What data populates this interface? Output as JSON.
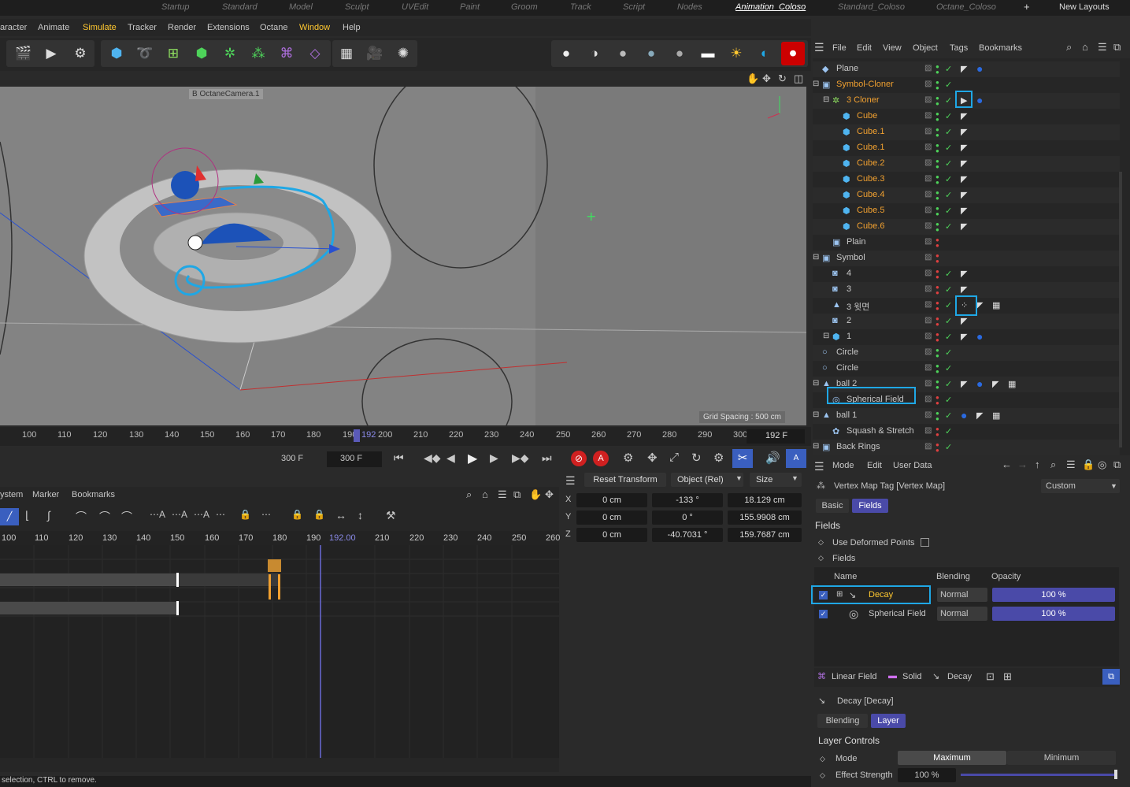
{
  "layout_tabs": [
    "Startup",
    "Standard",
    "Model",
    "Sculpt",
    "UVEdit",
    "Paint",
    "Groom",
    "Track",
    "Script",
    "Nodes",
    "Animation_Coloso",
    "Standard_Coloso",
    "Octane_Coloso",
    "+",
    "New Layouts"
  ],
  "menu": [
    "aracter",
    "Animate",
    "Simulate",
    "Tracker",
    "Render",
    "Extensions",
    "Octane",
    "Window",
    "Help"
  ],
  "viewport": {
    "camera_label": "B OctaneCamera.1",
    "grid_spacing": "Grid Spacing : 500 cm"
  },
  "ruler": {
    "ticks": [
      "100",
      "110",
      "120",
      "130",
      "140",
      "150",
      "160",
      "170",
      "180",
      "190",
      "200",
      "210",
      "220",
      "230",
      "240",
      "250",
      "260",
      "270",
      "280",
      "290",
      "300"
    ],
    "current_marker": "192",
    "current_frame": "192 F"
  },
  "transport": {
    "min_frame": "300 F",
    "max_frame": "300 F"
  },
  "timeline": {
    "menu": [
      "ystem",
      "Marker",
      "Bookmarks"
    ],
    "ticks": [
      "100",
      "110",
      "120",
      "130",
      "140",
      "150",
      "160",
      "170",
      "180",
      "190",
      "192.00",
      "210",
      "220",
      "230",
      "240",
      "250",
      "260"
    ]
  },
  "coord": {
    "reset": "Reset Transform",
    "mode": "Object (Rel)",
    "size": "Size",
    "axes": [
      "X",
      "Y",
      "Z"
    ],
    "pos": [
      "0 cm",
      "0 cm",
      "0 cm"
    ],
    "rot": [
      "-133 °",
      "0 °",
      "-40.7031 °"
    ],
    "scale": [
      "18.129 cm",
      "155.9908 cm",
      "159.7687 cm"
    ]
  },
  "status": "selection, CTRL to remove.",
  "object_manager": {
    "menu": [
      "File",
      "Edit",
      "View",
      "Object",
      "Tags",
      "Bookmarks"
    ],
    "rows": [
      {
        "name": "Plane",
        "color": "#c8c8c8",
        "indent": 0,
        "icon": "◆"
      },
      {
        "name": "Symbol-Cloner",
        "color": "#f0a030",
        "indent": 0,
        "icon": "▣"
      },
      {
        "name": "3 Cloner",
        "color": "#f0a030",
        "indent": 1,
        "icon": "✲"
      },
      {
        "name": "Cube",
        "color": "#f0a030",
        "indent": 2,
        "icon": "⬢"
      },
      {
        "name": "Cube.1",
        "color": "#f0a030",
        "indent": 2,
        "icon": "⬢"
      },
      {
        "name": "Cube.1",
        "color": "#f0a030",
        "indent": 2,
        "icon": "⬢"
      },
      {
        "name": "Cube.2",
        "color": "#f0a030",
        "indent": 2,
        "icon": "⬢"
      },
      {
        "name": "Cube.3",
        "color": "#f0a030",
        "indent": 2,
        "icon": "⬢"
      },
      {
        "name": "Cube.4",
        "color": "#f0a030",
        "indent": 2,
        "icon": "⬢"
      },
      {
        "name": "Cube.5",
        "color": "#f0a030",
        "indent": 2,
        "icon": "⬢"
      },
      {
        "name": "Cube.6",
        "color": "#f0a030",
        "indent": 2,
        "icon": "⬢"
      },
      {
        "name": "Plain",
        "color": "#c8c8c8",
        "indent": 1,
        "icon": "▣"
      },
      {
        "name": "Symbol",
        "color": "#c8c8c8",
        "indent": 0,
        "icon": "▣"
      },
      {
        "name": "4",
        "color": "#c8c8c8",
        "indent": 1,
        "icon": "◙"
      },
      {
        "name": "3",
        "color": "#c8c8c8",
        "indent": 1,
        "icon": "◙"
      },
      {
        "name": "3 윗면",
        "color": "#c8c8c8",
        "indent": 1,
        "icon": "▲"
      },
      {
        "name": "2",
        "color": "#c8c8c8",
        "indent": 1,
        "icon": "◙"
      },
      {
        "name": "1",
        "color": "#c8c8c8",
        "indent": 1,
        "icon": "⬢"
      },
      {
        "name": "Circle",
        "color": "#c8c8c8",
        "indent": 0,
        "icon": "○"
      },
      {
        "name": "Circle",
        "color": "#c8c8c8",
        "indent": 0,
        "icon": "○"
      },
      {
        "name": "ball 2",
        "color": "#c8c8c8",
        "indent": 0,
        "icon": "▲"
      },
      {
        "name": "Spherical Field",
        "color": "#c8c8c8",
        "indent": 1,
        "icon": "◎"
      },
      {
        "name": "ball 1",
        "color": "#c8c8c8",
        "indent": 0,
        "icon": "▲"
      },
      {
        "name": "Squash & Stretch",
        "color": "#c8c8c8",
        "indent": 1,
        "icon": "✿"
      },
      {
        "name": "Back Rings",
        "color": "#c8c8c8",
        "indent": 0,
        "icon": "▣"
      }
    ]
  },
  "attributes": {
    "menu": [
      "Mode",
      "Edit",
      "User Data"
    ],
    "title": "Vertex Map Tag [Vertex Map]",
    "preset": "Custom",
    "tabs": [
      "Basic",
      "Fields"
    ],
    "section": "Fields",
    "use_deformed": "Use Deformed Points",
    "fields_label": "Fields",
    "columns": [
      "Name",
      "Blending",
      "Opacity"
    ],
    "field_rows": [
      {
        "name": "Decay",
        "blend": "Normal",
        "opacity": "100 %"
      },
      {
        "name": "Spherical Field",
        "blend": "Normal",
        "opacity": "100 %"
      }
    ],
    "bottom_tools": [
      "Linear Field",
      "Solid",
      "Decay"
    ],
    "sub_title": "Decay [Decay]",
    "sub_tabs": [
      "Blending",
      "Layer"
    ],
    "layer_controls": "Layer Controls",
    "mode_label": "Mode",
    "mode_options": [
      "Maximum",
      "Minimum"
    ],
    "strength_label": "Effect Strength",
    "strength_value": "100 %"
  }
}
